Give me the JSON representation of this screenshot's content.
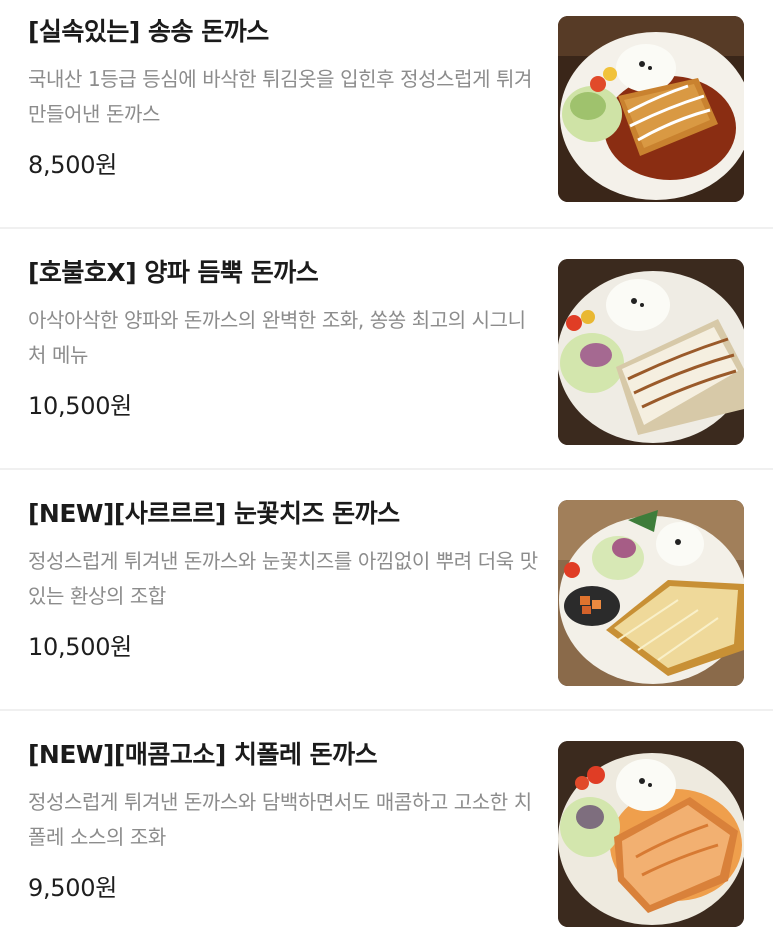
{
  "menu": {
    "items": [
      {
        "name": "[실속있는] 송송 돈까스",
        "description": "국내산 1등급 등심에 바삭한 튀김옷을 입힌후 정성스럽게 튀겨 만들어낸 돈까스",
        "price": "8,500원",
        "photo_icon": "tonkatsu-demiglace-photo"
      },
      {
        "name": "[호불호X] 양파 듬뿍 돈까스",
        "description": "아삭아삭한 양파와 돈까스의 완벽한 조화, 쏭쏭 최고의 시그니처 메뉴",
        "price": "10,500원",
        "photo_icon": "onion-tonkatsu-photo"
      },
      {
        "name": "[NEW][사르르르] 눈꽃치즈 돈까스",
        "description": "정성스럽게 튀겨낸 돈까스와 눈꽃치즈를 아낌없이 뿌려 더욱 맛있는 환상의 조합",
        "price": "10,500원",
        "photo_icon": "snow-cheese-tonkatsu-photo"
      },
      {
        "name": "[NEW][매콤고소] 치폴레 돈까스",
        "description": "정성스럽게 튀겨낸 돈까스와 담백하면서도 매콤하고 고소한 치폴레 소스의 조화",
        "price": "9,500원",
        "photo_icon": "chipotle-tonkatsu-photo"
      }
    ]
  },
  "colors": {
    "title": "#1b1b1b",
    "description": "#8c8c8c",
    "divider": "#f0f0f0",
    "plate": "#f3f1ec",
    "table": "#3b2a1e"
  }
}
